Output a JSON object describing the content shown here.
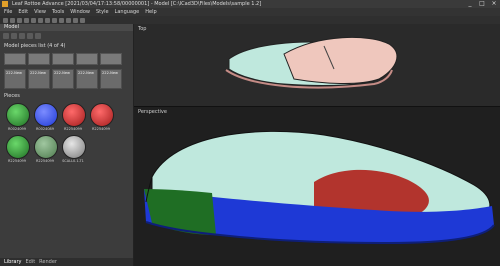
{
  "window": {
    "title": "Leaf Rottoe Advance [2021/03/04/17:13:58/00000001] - Model [C:\\ICad3D\\Files\\Models\\sample 1.2]",
    "menus": [
      "File",
      "Edit",
      "View",
      "Tools",
      "Window",
      "Style",
      "Language",
      "Help"
    ]
  },
  "left_panel": {
    "header": "Model",
    "pieces_title": "Model pieces list (4 of 4)",
    "pieces_labels": [
      "222-New",
      "222-New",
      "222-New",
      "222-New",
      "222-New"
    ],
    "materials_section": "Pieces",
    "materials": [
      {
        "label": "R0024099",
        "color": "#2a7a2a"
      },
      {
        "label": "R0024089",
        "color": "#2e4fc4"
      },
      {
        "label": "R2254099",
        "color": "#b51e1e"
      },
      {
        "label": "R2254099",
        "color": "#b51e1e"
      },
      {
        "label": "R2254099",
        "color": "#2a7a2a"
      },
      {
        "label": "R2254099",
        "color": "#4d7a4d"
      },
      {
        "label": "SCALL0.1-T1",
        "color": "#9b9b9b"
      }
    ],
    "tabs": [
      "Library",
      "Edit",
      "Render"
    ]
  },
  "viewports": {
    "top_label": "Top",
    "bottom_label": "Perspective"
  },
  "colors": {
    "accent": "#e2a02a",
    "upper_mint": "#bfe8dd",
    "vamp_pink": "#efc7bd",
    "sole_blue": "#1e39d6",
    "heel_green": "#1f6e24",
    "toe_red": "#b2342d"
  }
}
